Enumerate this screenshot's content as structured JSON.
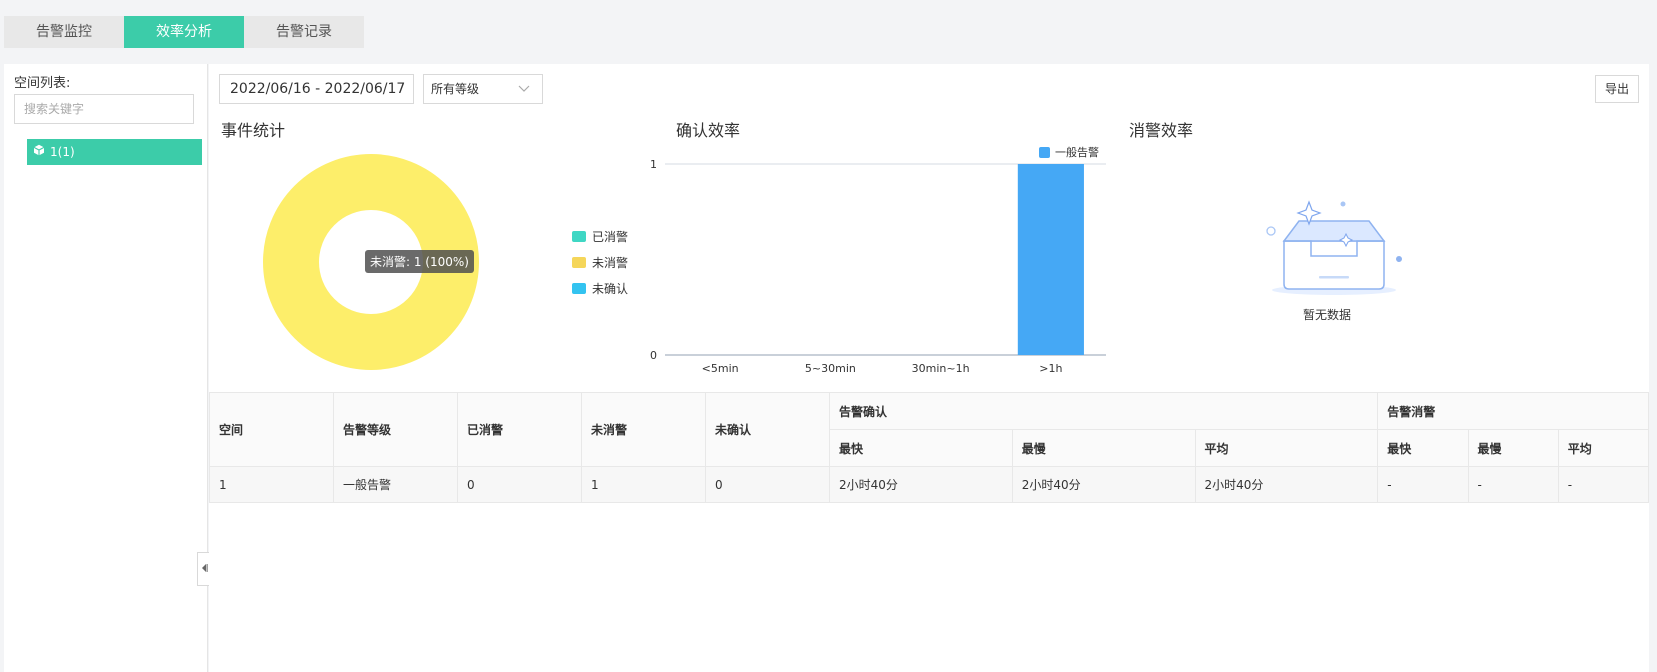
{
  "tabs": [
    {
      "label": "告警监控",
      "active": false
    },
    {
      "label": "效率分析",
      "active": true
    },
    {
      "label": "告警记录",
      "active": false
    }
  ],
  "sidebar": {
    "title": "空间列表:",
    "search_placeholder": "搜索关键字",
    "tree_items": [
      {
        "label": "1(1)",
        "icon": "cube-icon",
        "selected": true
      }
    ]
  },
  "toolbar": {
    "date_range": "2022/06/16 - 2022/06/17",
    "level_select": "所有等级",
    "export_label": "导出"
  },
  "colors": {
    "accent": "#3ccca9",
    "resolved": "#3fd7c4",
    "unresolved": "#fdee6a",
    "unconfirmed": "#33c3f0",
    "bar": "#45a8f5"
  },
  "panels": {
    "events": {
      "title": "事件统计",
      "tooltip": "未消警: 1 (100%)",
      "legend": [
        "已消警",
        "未消警",
        "未确认"
      ]
    },
    "confirm": {
      "title": "确认效率"
    },
    "resolve": {
      "title": "消警效率",
      "empty_text": "暂无数据"
    }
  },
  "chart_data": [
    {
      "type": "pie",
      "labels": [
        "已消警",
        "未消警",
        "未确认"
      ],
      "values": [
        0,
        1,
        0
      ],
      "donut": true
    },
    {
      "type": "bar",
      "categories": [
        "<5min",
        "5~30min",
        "30min~1h",
        ">1h"
      ],
      "series": [
        {
          "name": "一般告警",
          "values": [
            0,
            0,
            0,
            1
          ]
        }
      ],
      "ylim": [
        0,
        1
      ],
      "yticks": [
        "0",
        "1"
      ],
      "legend": "top-right"
    }
  ],
  "table": {
    "headers": {
      "space": "空间",
      "level": "告警等级",
      "resolved": "已消警",
      "unresolved": "未消警",
      "unconfirmed": "未确认",
      "confirm_group": "告警确认",
      "resolve_group": "告警消警",
      "fastest": "最快",
      "slowest": "最慢",
      "average": "平均"
    },
    "rows": [
      [
        "1",
        "一般告警",
        "0",
        "1",
        "0",
        "2小时40分",
        "2小时40分",
        "2小时40分",
        "-",
        "-",
        "-"
      ]
    ]
  }
}
